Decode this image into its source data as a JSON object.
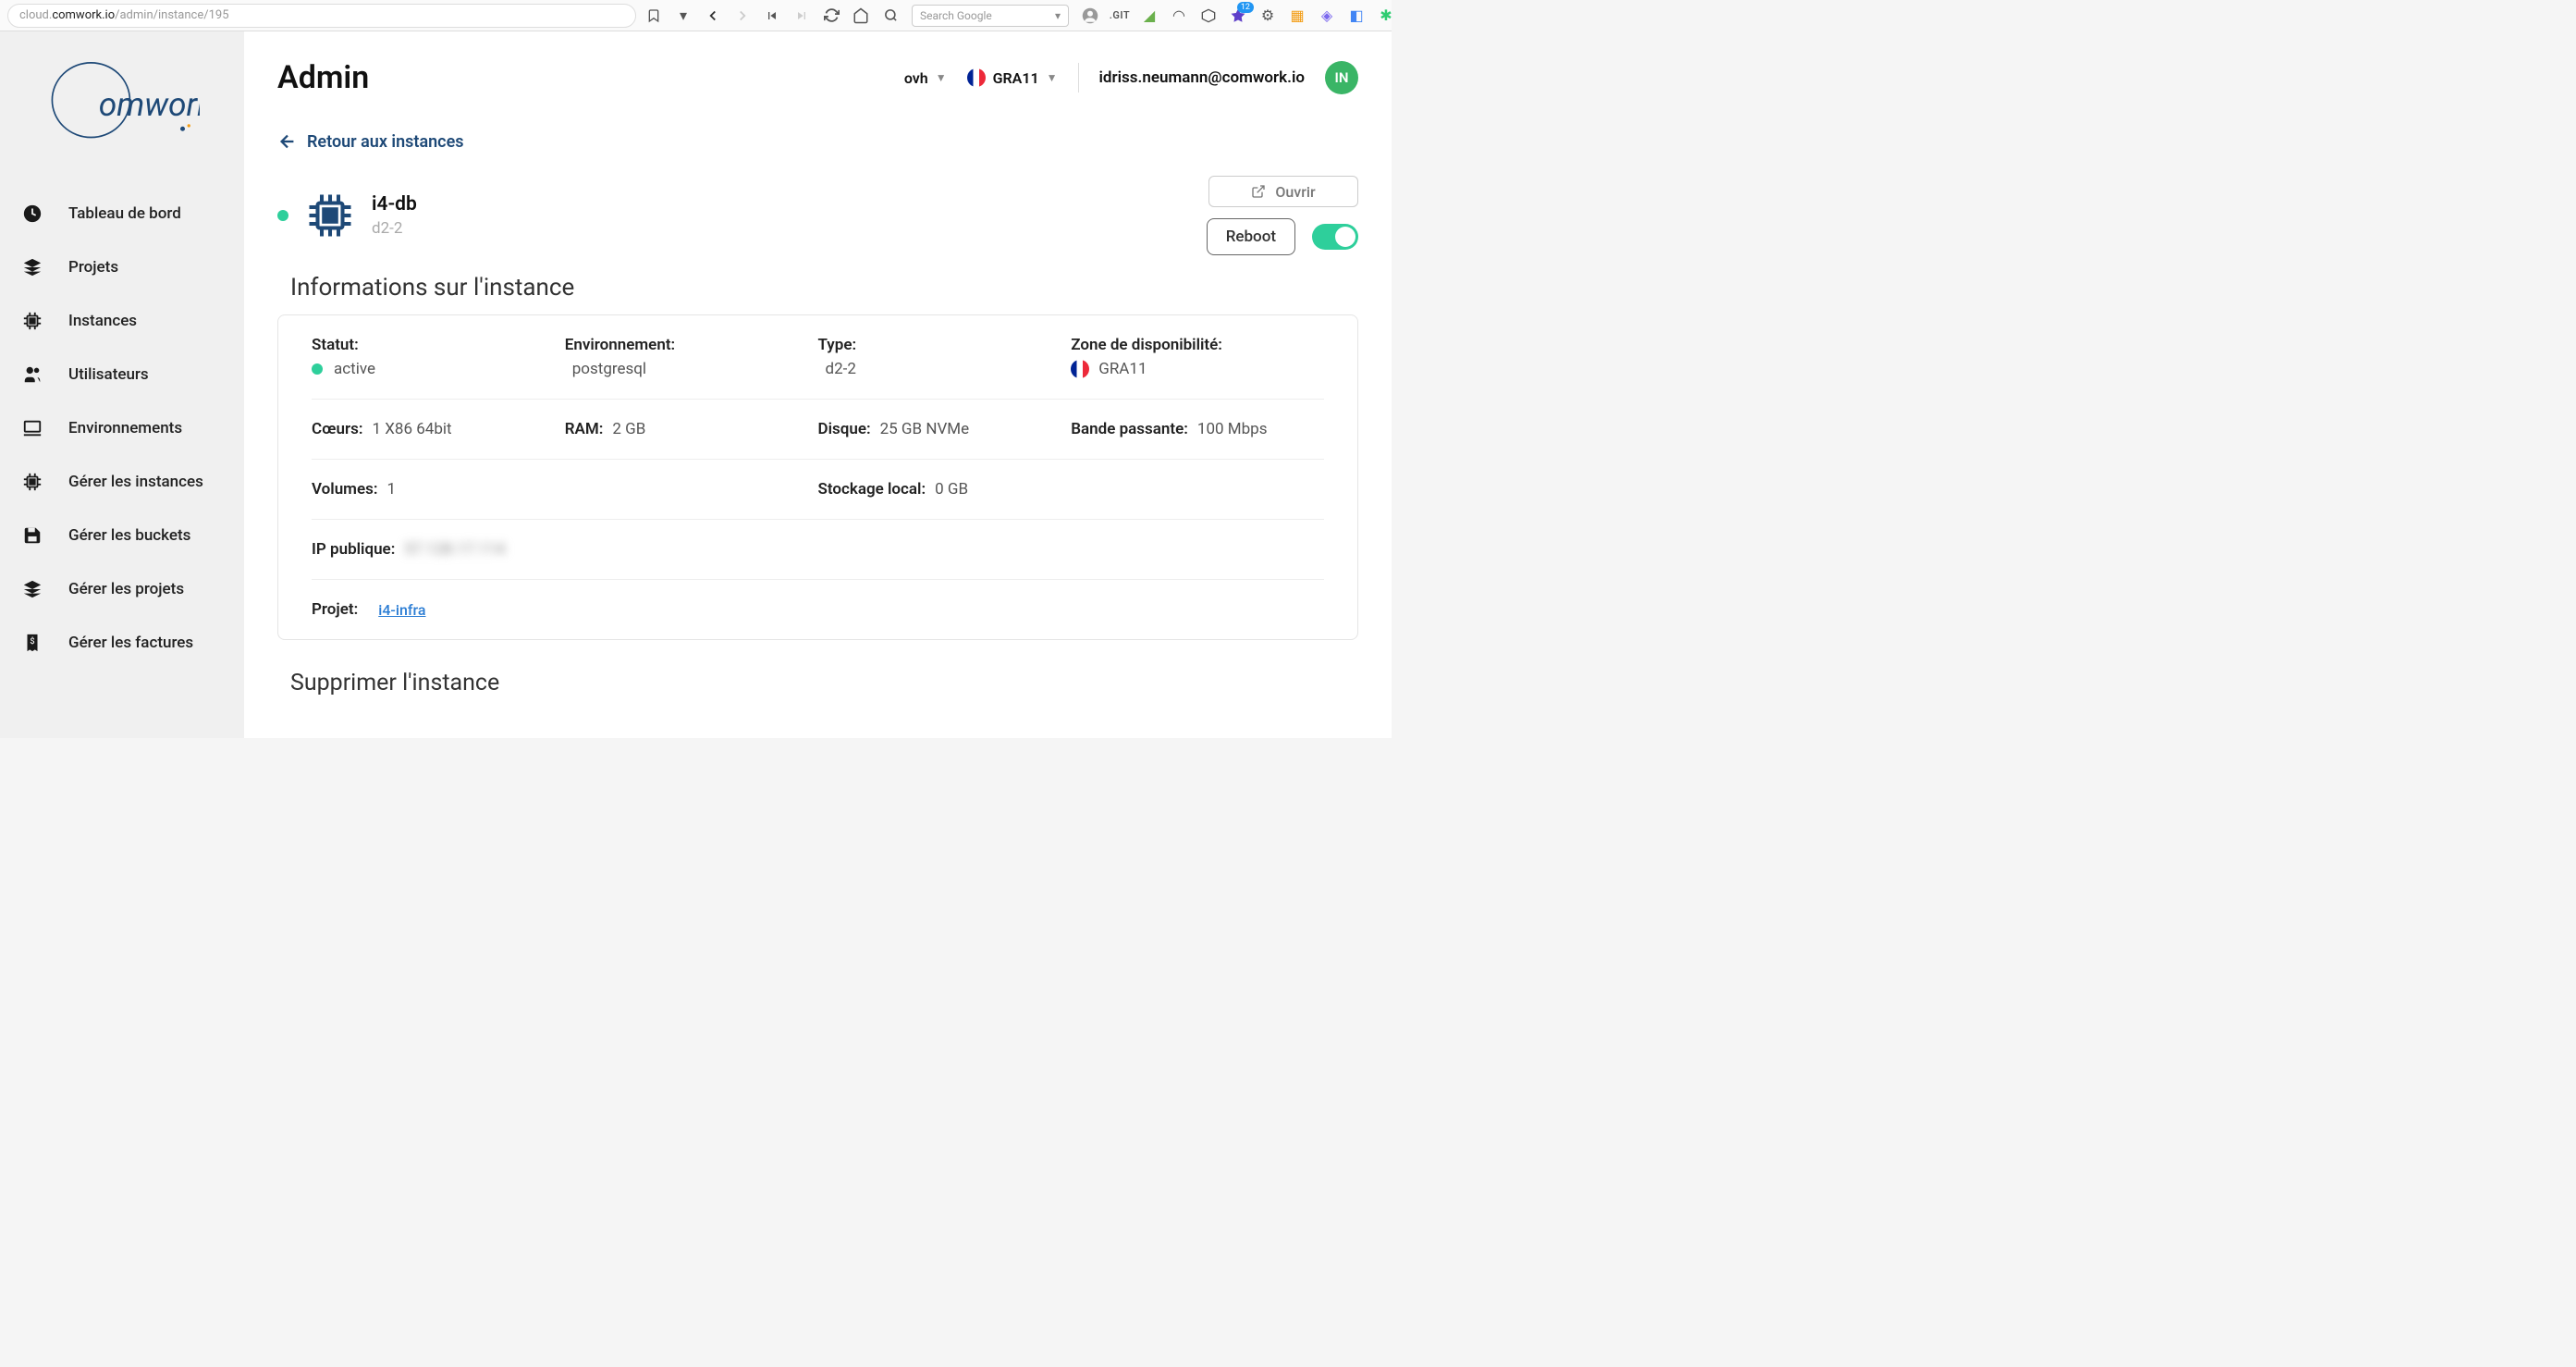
{
  "browser": {
    "url_prefix": "cloud.",
    "url_host": "comwork.io",
    "url_path": "/admin/instance/195",
    "search_placeholder": "Search Google",
    "git_label": ".GIT",
    "badge_count": "12"
  },
  "sidebar": {
    "logo_text": "Comwork",
    "items": [
      {
        "label": "Tableau de bord",
        "icon": "dashboard"
      },
      {
        "label": "Projets",
        "icon": "layers"
      },
      {
        "label": "Instances",
        "icon": "chip"
      },
      {
        "label": "Utilisateurs",
        "icon": "users"
      },
      {
        "label": "Environnements",
        "icon": "laptop"
      },
      {
        "label": "Gérer les instances",
        "icon": "chip"
      },
      {
        "label": "Gérer les buckets",
        "icon": "save"
      },
      {
        "label": "Gérer les projets",
        "icon": "layers"
      },
      {
        "label": "Gérer les factures",
        "icon": "receipt"
      }
    ]
  },
  "header": {
    "title": "Admin",
    "provider": "ovh",
    "region": "GRA11",
    "user_email": "idriss.neumann@comwork.io",
    "avatar_initials": "IN"
  },
  "back_link": "Retour aux instances",
  "instance": {
    "name": "i4-db",
    "size": "d2-2",
    "open_label": "Ouvrir",
    "reboot_label": "Reboot"
  },
  "info": {
    "section_title": "Informations sur l'instance",
    "status_label": "Statut:",
    "status_value": "active",
    "env_label": "Environnement:",
    "env_value": "postgresql",
    "type_label": "Type:",
    "type_value": "d2-2",
    "zone_label": "Zone de disponibilité:",
    "zone_value": "GRA11",
    "cores_label": "Cœurs:",
    "cores_value": "1 X86 64bit",
    "ram_label": "RAM:",
    "ram_value": "2 GB",
    "disk_label": "Disque:",
    "disk_value": "25 GB NVMe",
    "bandwidth_label": "Bande passante:",
    "bandwidth_value": "100 Mbps",
    "volumes_label": "Volumes:",
    "volumes_value": "1",
    "local_storage_label": "Stockage local:",
    "local_storage_value": "0 GB",
    "public_ip_label": "IP publique:",
    "public_ip_value": "57.128.17.114",
    "project_label": "Projet:",
    "project_value": "i4-infra"
  },
  "delete": {
    "section_title": "Supprimer l'instance"
  }
}
